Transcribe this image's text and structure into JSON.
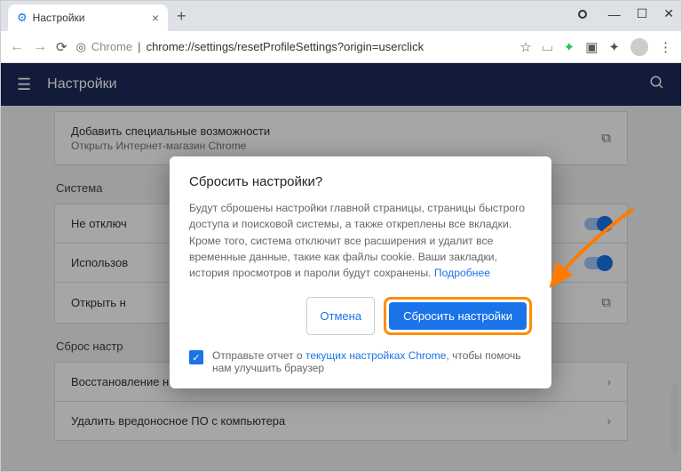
{
  "tab": {
    "title": "Настройки"
  },
  "addressbar": {
    "chrome_label": "Chrome",
    "url": "chrome://settings/resetProfileSettings?origin=userclick"
  },
  "header": {
    "title": "Настройки"
  },
  "accessibility": {
    "title": "Добавить специальные возможности",
    "sub": "Открыть Интернет-магазин Chrome"
  },
  "sections": {
    "system": "Система",
    "reset": "Сброс настр"
  },
  "rows": {
    "r1": "Не отключ",
    "r2": "Использов",
    "r3": "Открыть н",
    "r4": "Восстановление настроек по умолчанию",
    "r5": "Удалить вредоносное ПО с компьютера"
  },
  "dialog": {
    "title": "Сбросить настройки?",
    "body": "Будут сброшены настройки главной страницы, страницы быстрого доступа и поисковой системы, а также откреплены все вкладки. Кроме того, система отключит все расширения и удалит все временные данные, такие как файлы cookie. Ваши закладки, история просмотров и пароли будут сохранены. ",
    "more": "Подробнее",
    "cancel": "Отмена",
    "confirm": "Сбросить настройки",
    "footer_pre": "Отправьте отчет о ",
    "footer_link": "текущих настройках Chrome",
    "footer_post": ", чтобы помочь нам улучшить браузер"
  }
}
